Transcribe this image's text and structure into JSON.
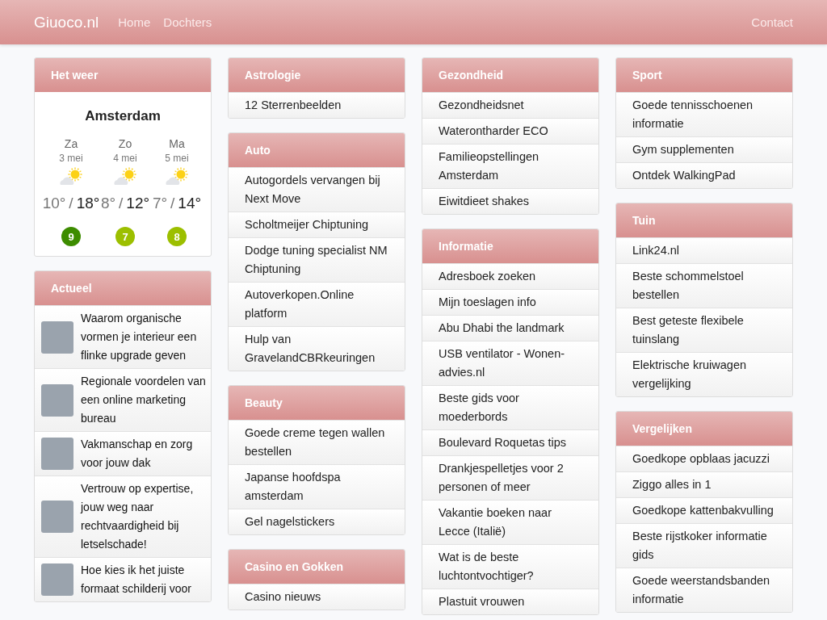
{
  "navbar": {
    "brand": "Giuoco.nl",
    "links": [
      {
        "label": "Home"
      },
      {
        "label": "Dochters"
      }
    ],
    "right_link": "Contact"
  },
  "columns": [
    [
      {
        "kind": "weather",
        "title": "Het weer",
        "city": "Amsterdam",
        "days": [
          {
            "day": "Za",
            "date": "3 mei",
            "low": "10°",
            "separator": "/",
            "high": "18°",
            "score": "9",
            "color": "#3d8c00"
          },
          {
            "day": "Zo",
            "date": "4 mei",
            "low": "8°",
            "separator": "/",
            "high": "12°",
            "score": "7",
            "color": "#9cbf00"
          },
          {
            "day": "Ma",
            "date": "5 mei",
            "low": "7°",
            "separator": "/",
            "high": "14°",
            "score": "8",
            "color": "#9cbf00"
          }
        ]
      },
      {
        "kind": "news",
        "title": "Actueel",
        "items": [
          "Waarom organische vormen je interieur een flinke upgrade geven",
          "Regionale voordelen van een online marketing bureau",
          "Vakmanschap en zorg voor jouw dak",
          "Vertrouw op expertise, jouw weg naar rechtvaardigheid bij letselschade!",
          "Hoe kies ik het juiste formaat schilderij voor"
        ]
      }
    ],
    [
      {
        "kind": "links",
        "title": "Astrologie",
        "items": [
          "12 Sterrenbeelden"
        ]
      },
      {
        "kind": "links",
        "title": "Auto",
        "items": [
          "Autogordels vervangen bij Next Move",
          "Scholtmeijer Chiptuning",
          "Dodge tuning specialist NM Chiptuning",
          "Autoverkopen.Online platform",
          "Hulp van GravelandCBRkeuringen"
        ]
      },
      {
        "kind": "links",
        "title": "Beauty",
        "items": [
          "Goede creme tegen wallen bestellen",
          "Japanse hoofdspa amsterdam",
          "Gel nagelstickers"
        ]
      },
      {
        "kind": "links",
        "title": "Casino en Gokken",
        "items": [
          "Casino nieuws"
        ]
      }
    ],
    [
      {
        "kind": "links",
        "title": "Gezondheid",
        "items": [
          "Gezondheidsnet",
          "Waterontharder ECO",
          "Familieopstellingen Amsterdam",
          "Eiwitdieet shakes"
        ]
      },
      {
        "kind": "links",
        "title": "Informatie",
        "items": [
          "Adresboek zoeken",
          "Mijn toeslagen info",
          "Abu Dhabi the landmark",
          "USB ventilator - Wonen-advies.nl",
          "Beste gids voor moederbords",
          "Boulevard Roquetas tips",
          "Drankjespelletjes voor 2 personen of meer",
          "Vakantie boeken naar Lecce (Italië)",
          "Wat is de beste luchtontvochtiger?",
          "Plastuit vrouwen"
        ]
      }
    ],
    [
      {
        "kind": "links",
        "title": "Sport",
        "items": [
          "Goede tennisschoenen informatie",
          "Gym supplementen",
          "Ontdek WalkingPad"
        ]
      },
      {
        "kind": "links",
        "title": "Tuin",
        "items": [
          "Link24.nl",
          "Beste schommelstoel bestellen",
          "Best geteste flexibele tuinslang",
          "Elektrische kruiwagen vergelijking"
        ]
      },
      {
        "kind": "links",
        "title": "Vergelijken",
        "items": [
          "Goedkope opblaas jacuzzi",
          "Ziggo alles in 1",
          "Goedkope kattenbakvulling",
          "Beste rijstkoker informatie gids",
          "Goede weerstandsbanden informatie"
        ]
      }
    ]
  ]
}
